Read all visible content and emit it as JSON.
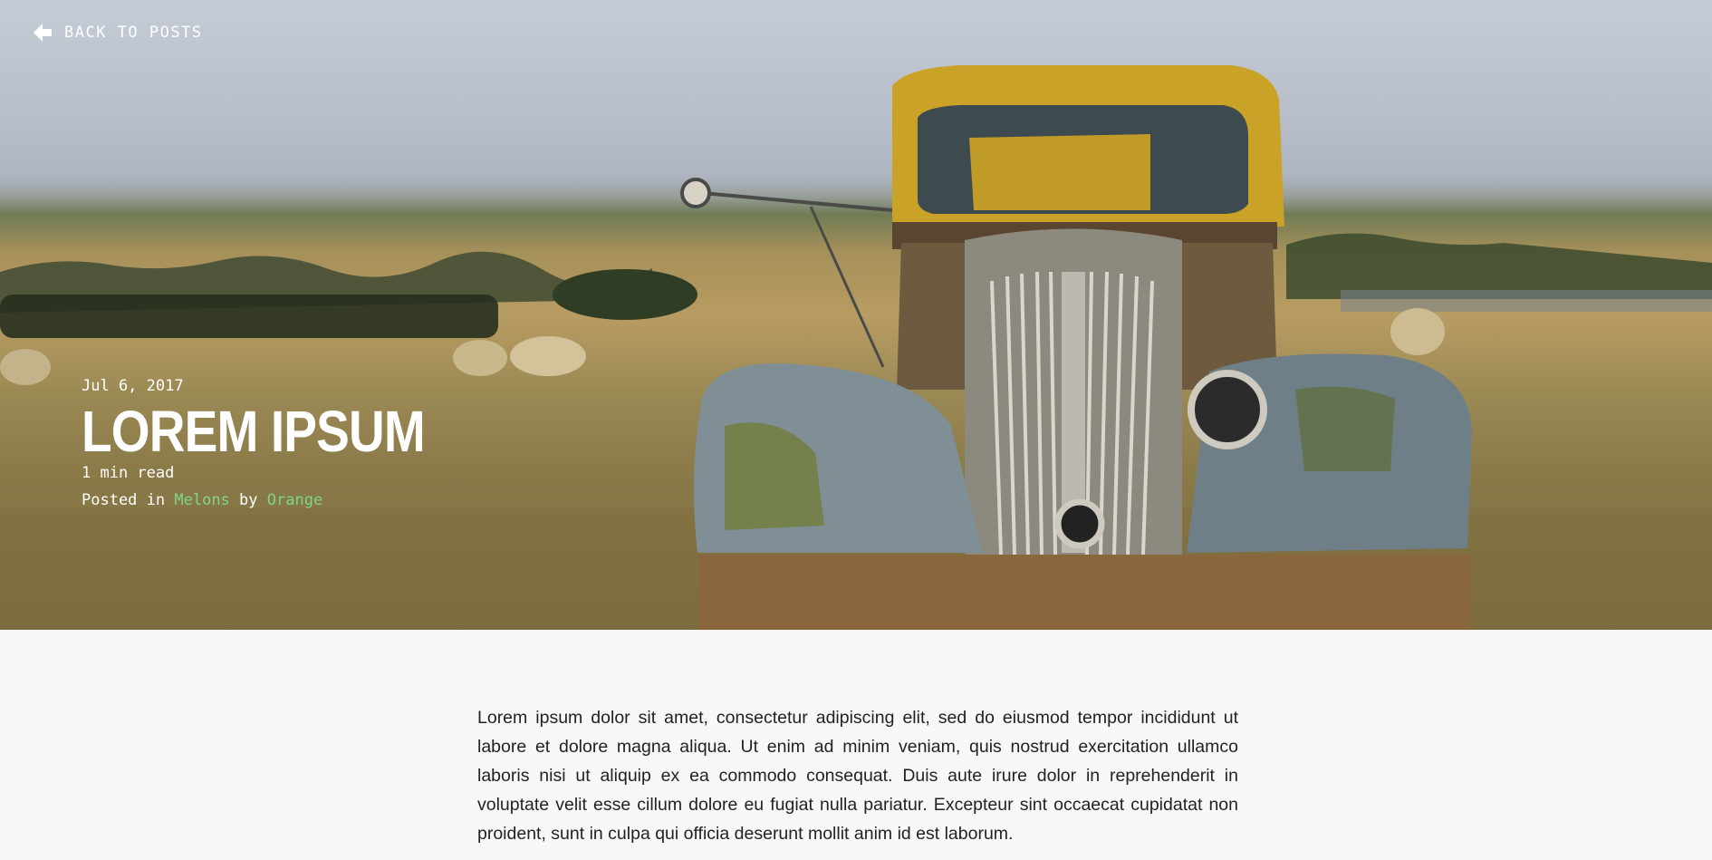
{
  "nav": {
    "back_label": "BACK TO POSTS"
  },
  "post": {
    "date": "Jul 6, 2017",
    "title": "LOREM IPSUM",
    "read_time": "1 min read",
    "posted_in_prefix": "Posted in",
    "category": "Melons",
    "by_word": "by",
    "author": "Orange",
    "body": "Lorem ipsum dolor sit amet, consectetur adipiscing elit, sed do eiusmod tempor incididunt ut labore et dolore magna aliqua. Ut enim ad minim veniam, quis nostrud exercitation ullamco laboris nisi ut aliquip ex ea commodo consequat. Duis aute irure dolor in reprehenderit in voluptate velit esse cillum dolore eu fugiat nulla pariatur. Excepteur sint occaecat cupidatat non proident, sunt in culpa qui officia deserunt mollit anim id est laborum."
  },
  "colors": {
    "link": "#7ed68a",
    "page_background": "#f8f8f8",
    "text": "#222222"
  },
  "icons": {
    "back": "arrow-left-icon"
  }
}
